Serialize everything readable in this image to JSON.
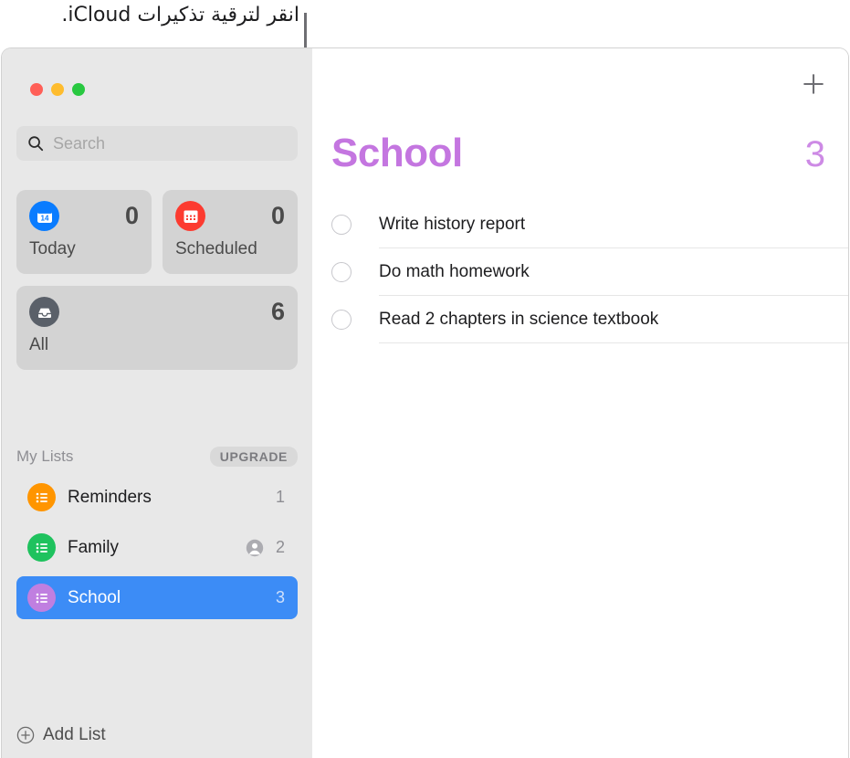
{
  "callout": {
    "text": "انقر لترقية تذكيرات iCloud.",
    "line_color": "#6e6e73"
  },
  "window": {
    "traffic_lights": [
      {
        "name": "close",
        "color": "#ff5f57"
      },
      {
        "name": "minimize",
        "color": "#febc2e"
      },
      {
        "name": "zoom",
        "color": "#28c840"
      }
    ]
  },
  "sidebar": {
    "search": {
      "icon": "search-icon",
      "value": "",
      "placeholder": "Search"
    },
    "smart_lists": [
      {
        "id": "today",
        "label": "Today",
        "count": "0",
        "icon": "calendar-day-icon",
        "icon_color": "#0a7cff",
        "day_number": "14"
      },
      {
        "id": "scheduled",
        "label": "Scheduled",
        "count": "0",
        "icon": "calendar-grid-icon",
        "icon_color": "#fc3b30"
      },
      {
        "id": "all",
        "label": "All",
        "count": "6",
        "icon": "inbox-tray-icon",
        "icon_color": "#5a6069"
      }
    ],
    "my_lists": {
      "title": "My Lists",
      "upgrade_label": "UPGRADE",
      "items": [
        {
          "id": "reminders",
          "label": "Reminders",
          "count": "1",
          "icon": "list-bullet-icon",
          "icon_color": "#ff9500",
          "shared": false,
          "selected": false
        },
        {
          "id": "family",
          "label": "Family",
          "count": "2",
          "icon": "list-bullet-icon",
          "icon_color": "#1fc25e",
          "shared": true,
          "shared_icon": "person-circle-icon",
          "selected": false
        },
        {
          "id": "school",
          "label": "School",
          "count": "3",
          "icon": "list-bullet-icon",
          "icon_color": "#c07fe0",
          "shared": false,
          "selected": true
        }
      ]
    },
    "add_list": {
      "label": "Add List",
      "icon": "plus-circle-icon"
    }
  },
  "content": {
    "add_reminder_icon": "plus-icon",
    "title": "School",
    "title_color": "#c476e0",
    "total_count": "3",
    "reminders": [
      {
        "text": "Write history report",
        "completed": false
      },
      {
        "text": "Do math homework",
        "completed": false
      },
      {
        "text": "Read 2 chapters in science textbook",
        "completed": false
      }
    ]
  }
}
